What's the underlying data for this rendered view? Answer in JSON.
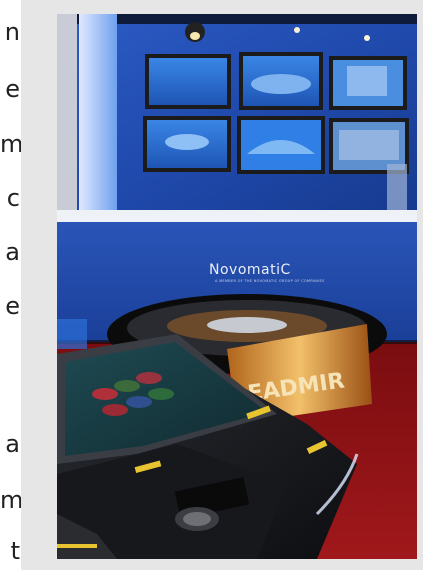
{
  "left_text_fragments": [
    "n",
    "e",
    "m",
    "c",
    "a",
    "e",
    "a",
    "m",
    "t"
  ],
  "photo": {
    "brand_logo": "NovomatiC",
    "brand_tagline": "A MEMBER OF THE NOVOMATIC GROUP OF COMPANIES",
    "roulette_rim_text": "EADMIR",
    "colors": {
      "wall_blue": "#1f4bb0",
      "floor_red": "#8a0f12",
      "counter_white": "#e9edf3",
      "screen_blue": "#2e77d8"
    }
  }
}
